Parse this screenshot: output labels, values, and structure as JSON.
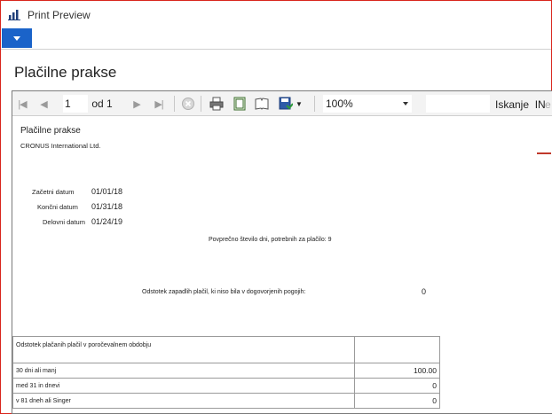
{
  "window": {
    "title": "Print Preview"
  },
  "page": {
    "title": "Plačilne prakse"
  },
  "toolbar": {
    "page_current": "1",
    "page_of": "od 1",
    "zoom": "100%",
    "search_label": "Iskanje",
    "search_next": "IN",
    "search_tail": "e"
  },
  "report": {
    "title": "Plačilne prakse",
    "company": "CRONUS International Ltd.",
    "fields": [
      {
        "label": "Začetni datum",
        "value": "01/01/18"
      },
      {
        "label": "Končni datum",
        "value": "01/31/18"
      },
      {
        "label": "Delovni datum",
        "value": "01/24/19"
      }
    ],
    "avg_days": "Povprečno število dni, potrebnih za plačilo: 9",
    "late_pct_label": "Odstotek zapadlih plačil, ki niso bila v dogovorjenih pogojih:",
    "late_pct_value": "0",
    "table": {
      "header": "Odstotek plačanih plačil v poročevalnem obdobju",
      "rows": [
        {
          "label": "30 dni ali manj",
          "value": "100.00"
        },
        {
          "label": "med 31 in dnevi",
          "value": "0"
        },
        {
          "label": "v 81 dneh ali Singer",
          "value": "0"
        }
      ]
    }
  },
  "colors": {
    "accent": "#1a63c9",
    "frame": "#d9251c"
  }
}
